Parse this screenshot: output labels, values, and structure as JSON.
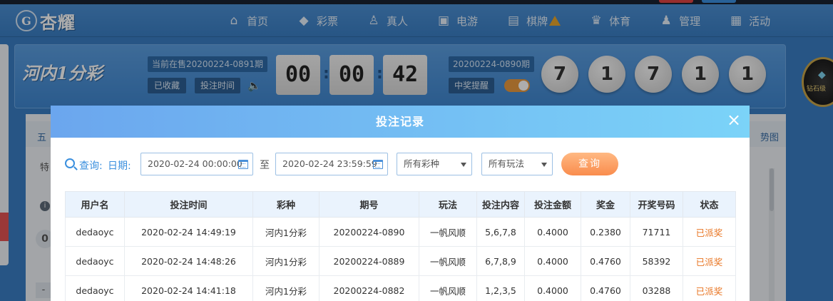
{
  "nav": {
    "logo_text": "杏耀",
    "items": [
      {
        "label": "首页",
        "icon": "home-icon"
      },
      {
        "label": "彩票",
        "icon": "tag-icon"
      },
      {
        "label": "真人",
        "icon": "person-icon"
      },
      {
        "label": "电游",
        "icon": "gamepad-icon"
      },
      {
        "label": "棋牌",
        "icon": "cards-icon"
      },
      {
        "label": "体育",
        "icon": "trophy-icon"
      },
      {
        "label": "管理",
        "icon": "users-icon"
      },
      {
        "label": "活动",
        "icon": "gift-icon"
      }
    ]
  },
  "lottery": {
    "name": "河内1分彩",
    "current_period": "当前在售20200224-0891期",
    "favorited_label": "已收藏",
    "bet_time_label": "投注时间",
    "countdown": [
      "00",
      "00",
      "42"
    ],
    "last_period": "20200224-0890期",
    "win_remind_label": "中奖提醒",
    "balls": [
      "7",
      "1",
      "7",
      "1",
      "1"
    ],
    "vip_badge": "钻石级"
  },
  "background": {
    "tab_text": "五",
    "trend_label": "势图",
    "side_label": "特",
    "zero": "0",
    "dash": "-"
  },
  "modal": {
    "title": "投注记录",
    "close": "×",
    "filter": {
      "query_label": "查询:",
      "date_label": "日期:",
      "start_date": "2020-02-24 00:00:00",
      "to_label": "至",
      "end_date": "2020-02-24 23:59:59",
      "lottery_select": "所有彩种",
      "play_select": "所有玩法",
      "query_button": "查询"
    },
    "columns": [
      "用户名",
      "投注时间",
      "彩种",
      "期号",
      "玩法",
      "投注内容",
      "投注金额",
      "奖金",
      "开奖号码",
      "状态"
    ],
    "rows": [
      [
        "dedaoyc",
        "2020-02-24 14:49:19",
        "河内1分彩",
        "20200224-0890",
        "一帆风顺",
        "5,6,7,8",
        "0.4000",
        "0.2380",
        "71711",
        "已派奖"
      ],
      [
        "dedaoyc",
        "2020-02-24 14:48:26",
        "河内1分彩",
        "20200224-0889",
        "一帆风顺",
        "6,7,8,9",
        "0.4000",
        "0.4760",
        "58392",
        "已派奖"
      ],
      [
        "dedaoyc",
        "2020-02-24 14:41:18",
        "河内1分彩",
        "20200224-0882",
        "一帆风顺",
        "1,2,3,5",
        "0.4000",
        "0.4760",
        "03288",
        "已派奖"
      ]
    ]
  },
  "colors": {
    "accent": "#3a8fde",
    "paid_status": "#e8731f",
    "query_button": "#f98c4d"
  }
}
